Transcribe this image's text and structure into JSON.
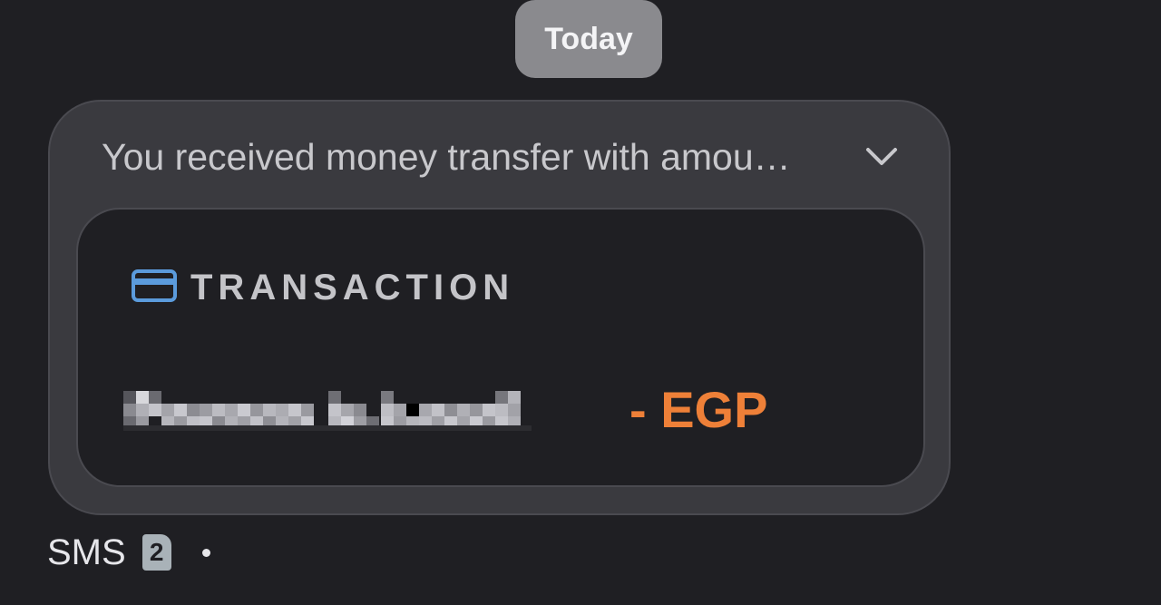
{
  "date_chip": {
    "label": "Today"
  },
  "message": {
    "preview": "You received money transfer with amou…",
    "card": {
      "icon": "credit-card-icon",
      "title": "TRANSACTION",
      "sender": "",
      "amount": "- EGP",
      "amount_color": "#ee8038",
      "icon_color": "#5b9bdc"
    }
  },
  "footer": {
    "channel": "SMS",
    "sim": "2",
    "sim_icon": "sim-card-icon"
  }
}
